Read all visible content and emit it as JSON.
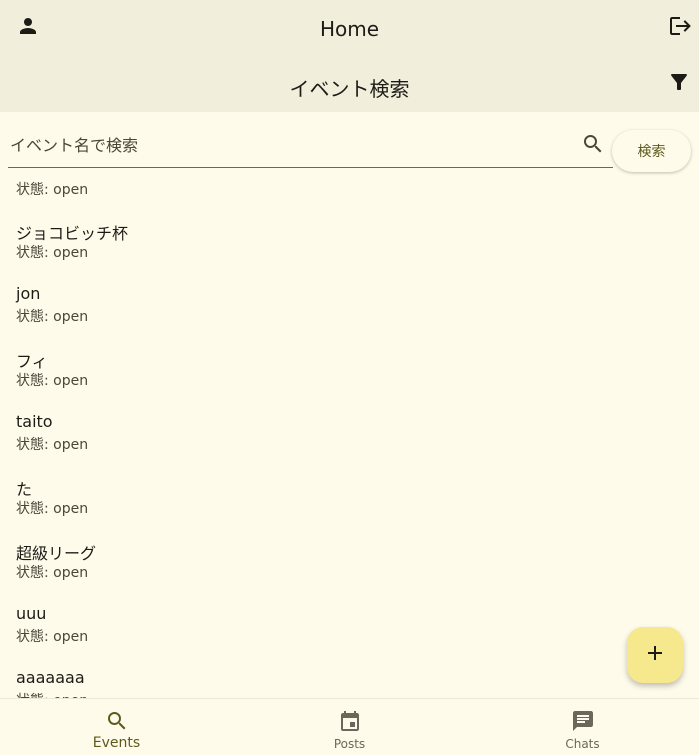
{
  "appbar": {
    "title": "Home",
    "subtitle": "イベント検索",
    "icons": {
      "account": "person-icon",
      "logout": "logout-icon",
      "filter": "filter-icon"
    }
  },
  "search": {
    "placeholder": "イベント名で検索",
    "value": "",
    "button_label": "検索",
    "icon": "search-icon"
  },
  "events": [
    {
      "title": "",
      "status": "状態: open"
    },
    {
      "title": "ジョコビッチ杯",
      "status": "状態: open"
    },
    {
      "title": "jon",
      "status": "状態: open"
    },
    {
      "title": "フィ",
      "status": "状態: open"
    },
    {
      "title": "taito",
      "status": "状態: open"
    },
    {
      "title": "た",
      "status": "状態: open"
    },
    {
      "title": "超級リーグ",
      "status": "状態: open"
    },
    {
      "title": "uuu",
      "status": "状態: open"
    },
    {
      "title": "aaaaaaa",
      "status": "状態: open"
    }
  ],
  "fab": {
    "icon": "add-icon"
  },
  "bottom_nav": [
    {
      "label": "Events",
      "icon": "search-icon",
      "active": true
    },
    {
      "label": "Posts",
      "icon": "calendar-icon",
      "active": false
    },
    {
      "label": "Chats",
      "icon": "chat-icon",
      "active": false
    }
  ],
  "colors": {
    "background": "#fffbeb",
    "appbar": "#f1eedb",
    "accent": "#5c5a1b",
    "fab": "#f5e88d"
  }
}
